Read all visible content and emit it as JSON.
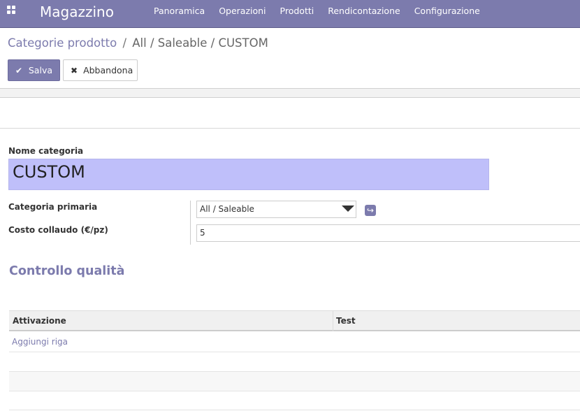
{
  "navbar": {
    "apps_icon": "apps-grid-icon",
    "brand": "Magazzino",
    "menu": [
      "Panoramica",
      "Operazioni",
      "Prodotti",
      "Rendicontazione",
      "Configurazione"
    ]
  },
  "breadcrumb": {
    "link": "Categorie prodotto",
    "separator": "/",
    "current": "All / Saleable / CUSTOM"
  },
  "buttons": {
    "save_label": "Salva",
    "save_icon": "check-icon",
    "discard_label": "Abbandona",
    "discard_icon": "times-icon"
  },
  "form": {
    "name_label": "Nome categoria",
    "name_value": "CUSTOM",
    "parent_label": "Categoria primaria",
    "parent_value": "All / Saleable",
    "cost_label": "Costo collaudo (€/pz)",
    "cost_value": "5"
  },
  "quality": {
    "title": "Controllo qualità",
    "columns": [
      "Attivazione",
      "Test"
    ],
    "add_line": "Aggiungi riga"
  },
  "colors": {
    "primary": "#7c7bad",
    "name_field_bg": "#bfbffa"
  }
}
